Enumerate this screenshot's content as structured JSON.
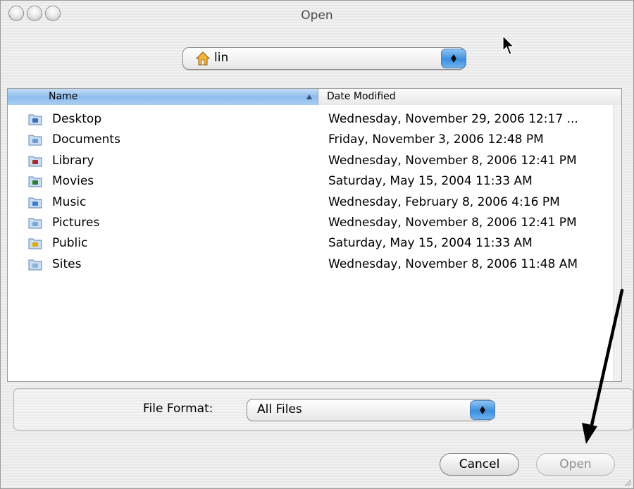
{
  "window": {
    "title": "Open"
  },
  "path_popup": {
    "label": "lin",
    "icon": "home-icon"
  },
  "columns": {
    "name": "Name",
    "date": "Date Modified",
    "sorted_by": "name"
  },
  "rows": [
    {
      "name": "Desktop",
      "date": "Wednesday, November 29, 2006 12:17 ...",
      "icon": "desktop-folder-icon",
      "color": "#3b6fb9"
    },
    {
      "name": "Documents",
      "date": "Friday, November 3, 2006 12:48 PM",
      "icon": "documents-folder-icon",
      "color": "#6f9ccc"
    },
    {
      "name": "Library",
      "date": "Wednesday, November 8, 2006 12:41 PM",
      "icon": "library-folder-icon",
      "color": "#a52a2a"
    },
    {
      "name": "Movies",
      "date": "Saturday, May 15, 2004 11:33 AM",
      "icon": "movies-folder-icon",
      "color": "#2e7d32"
    },
    {
      "name": "Music",
      "date": "Wednesday, February 8, 2006 4:16 PM",
      "icon": "music-folder-icon",
      "color": "#3d7fcf"
    },
    {
      "name": "Pictures",
      "date": "Wednesday, November 8, 2006 12:41 PM",
      "icon": "pictures-folder-icon",
      "color": "#7ea7d3"
    },
    {
      "name": "Public",
      "date": "Saturday, May 15, 2004 11:33 AM",
      "icon": "public-folder-icon",
      "color": "#e0a800"
    },
    {
      "name": "Sites",
      "date": "Wednesday, November 8, 2006 11:48 AM",
      "icon": "sites-folder-icon",
      "color": "#8cb3dc"
    }
  ],
  "format": {
    "label": "File Format:",
    "value": "All Files"
  },
  "buttons": {
    "cancel": "Cancel",
    "open": "Open",
    "open_enabled": false
  }
}
